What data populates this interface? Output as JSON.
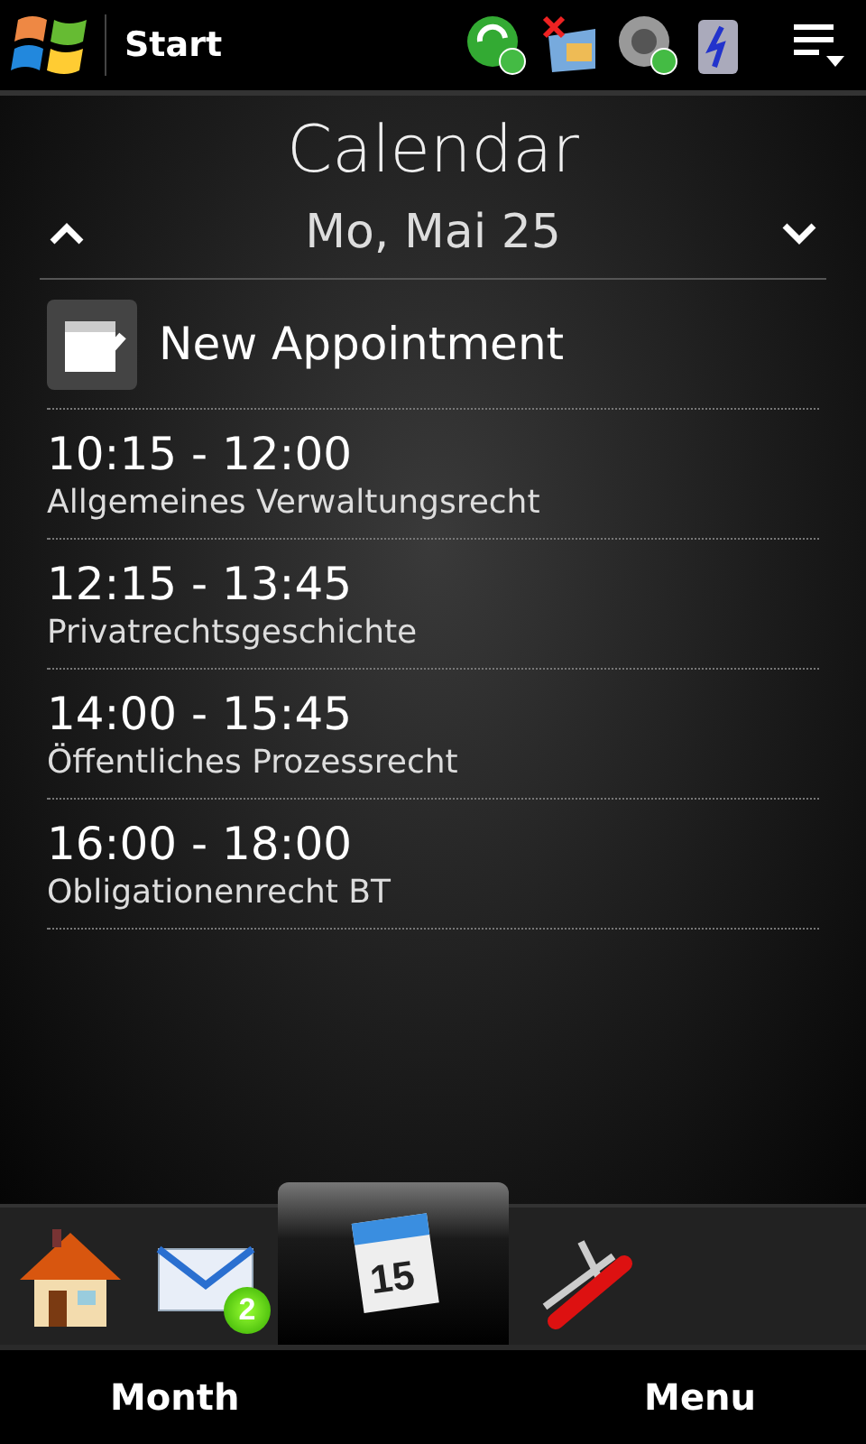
{
  "top_bar": {
    "title": "Start"
  },
  "header": {
    "title": "Calendar",
    "date": "Mo, Mai 25"
  },
  "new_appointment": {
    "label": "New Appointment"
  },
  "appointments": [
    {
      "time": "10:15 - 12:00",
      "subject": "Allgemeines Verwaltungsrecht"
    },
    {
      "time": "12:15 - 13:45",
      "subject": "Privatrechtsgeschichte"
    },
    {
      "time": "14:00 - 15:45",
      "subject": "Öffentliches Prozessrecht"
    },
    {
      "time": "16:00 - 18:00",
      "subject": "Obligationenrecht BT"
    }
  ],
  "tabs": [
    {
      "kind": "home",
      "selected": false
    },
    {
      "kind": "mail",
      "selected": false,
      "badge": "2"
    },
    {
      "kind": "calendar",
      "selected": true,
      "day": "15"
    },
    {
      "kind": "tools",
      "selected": false
    }
  ],
  "soft_keys": [
    "Month",
    "Menu"
  ]
}
